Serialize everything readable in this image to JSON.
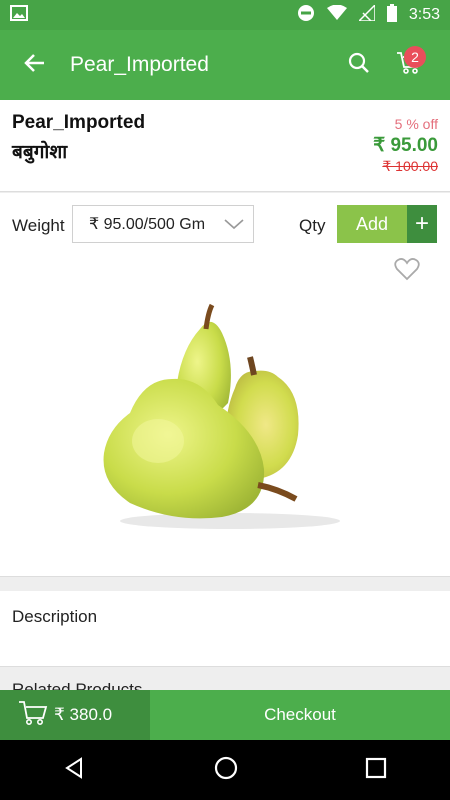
{
  "status_bar": {
    "time": "3:53"
  },
  "app_bar": {
    "title": "Pear_Imported",
    "cart_count": "2"
  },
  "product": {
    "name": "Pear_Imported",
    "local_name": "बबुगोशा",
    "discount": "5 % off",
    "price": "₹ 95.00",
    "mrp": "₹ 100.00"
  },
  "options": {
    "weight_label": "Weight",
    "weight_value": "₹ 95.00/500 Gm",
    "qty_label": "Qty",
    "add_label": "Add",
    "plus_label": "+"
  },
  "description": {
    "label": "Description"
  },
  "related": {
    "label": "Related Products"
  },
  "bottom_bar": {
    "cart_total": "₹ 380.0",
    "checkout_label": "Checkout"
  },
  "colors": {
    "primary": "#4cae4c",
    "primary_dark": "#3e8e3e",
    "accent_light": "#8bc34a",
    "discount": "#e46f7c",
    "mrp": "#dd3333"
  }
}
